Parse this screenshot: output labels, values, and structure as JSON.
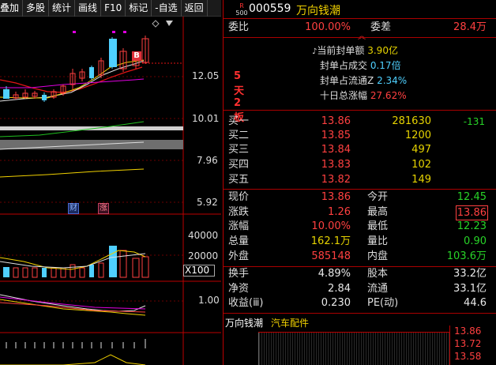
{
  "toolbar": {
    "buttons": [
      "叠加",
      "多股",
      "统计",
      "画线",
      "F10",
      "标记",
      "-自选",
      "返回"
    ]
  },
  "chart": {
    "price_labels": [
      "12.05",
      "10.01",
      "7.96",
      "5.92"
    ],
    "volume_labels": [
      "40000",
      "20000"
    ],
    "volume_unit": "X100",
    "indicator_label": "1.00",
    "event_icons": [
      "财",
      "涨"
    ],
    "marker_b": "B",
    "annotation": "5天2板"
  },
  "quote": {
    "market_badge": "R",
    "market_badge_sub": "500",
    "code": "000559",
    "name": "万向钱潮",
    "weibi_label": "委比",
    "weibi_value": "100.00%",
    "weicha_label": "委差",
    "weicha_value": "28.4万",
    "seal": [
      {
        "label": "当前封单额",
        "value": "3.90亿",
        "prefix": "♪"
      },
      {
        "label": "封单占成交",
        "value": "0.17倍"
      },
      {
        "label": "封单占流通Z",
        "value": "2.34%"
      },
      {
        "label": "十日总涨幅",
        "value": "27.62%"
      }
    ],
    "buys": [
      {
        "label": "买一",
        "price": "13.86",
        "vol": "281630",
        "chg": "-131"
      },
      {
        "label": "买二",
        "price": "13.85",
        "vol": "1200",
        "chg": ""
      },
      {
        "label": "买三",
        "price": "13.84",
        "vol": "497",
        "chg": ""
      },
      {
        "label": "买四",
        "price": "13.83",
        "vol": "102",
        "chg": ""
      },
      {
        "label": "买五",
        "price": "13.82",
        "vol": "149",
        "chg": ""
      }
    ],
    "stats_left": [
      {
        "label": "现价",
        "value": "13.86"
      },
      {
        "label": "涨跌",
        "value": "1.26"
      },
      {
        "label": "涨幅",
        "value": "10.00%"
      },
      {
        "label": "总量",
        "value": "162.1万"
      },
      {
        "label": "外盘",
        "value": "585148"
      }
    ],
    "stats_right": [
      {
        "label": "今开",
        "value": "12.45"
      },
      {
        "label": "最高",
        "value": "13.86"
      },
      {
        "label": "最低",
        "value": "12.23"
      },
      {
        "label": "量比",
        "value": "0.90"
      },
      {
        "label": "内盘",
        "value": "103.6万"
      }
    ],
    "fin_left": [
      {
        "label": "换手",
        "value": "4.89%"
      },
      {
        "label": "净资",
        "value": "2.84"
      },
      {
        "label": "收益(ⅲ)",
        "value": "0.230"
      }
    ],
    "fin_right": [
      {
        "label": "股本",
        "value": "33.2亿"
      },
      {
        "label": "流通",
        "value": "33.1亿"
      },
      {
        "label": "PE(动)",
        "value": "44.6"
      }
    ],
    "mini": {
      "name": "万向钱潮",
      "sector": "汽车配件",
      "labels": [
        "13.86",
        "13.72",
        "13.58"
      ]
    }
  }
}
